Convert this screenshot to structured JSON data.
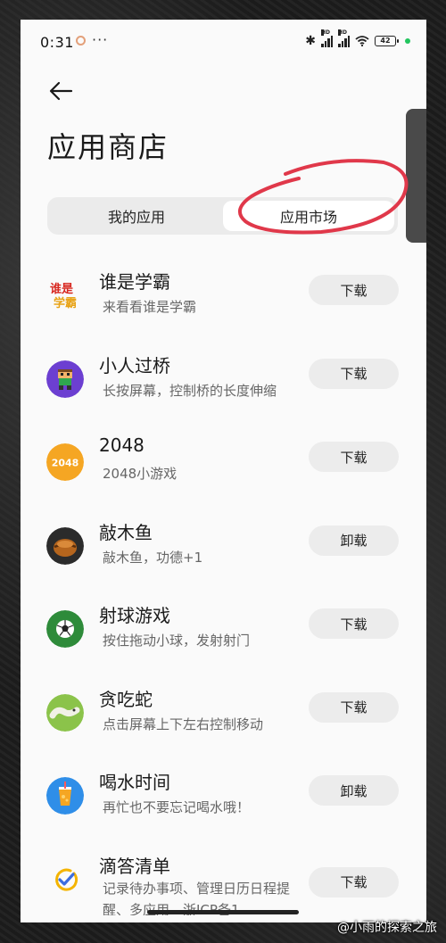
{
  "status_bar": {
    "time": "0:31",
    "more": "···",
    "battery": "42",
    "signal_label": "HD"
  },
  "header": {
    "title": "应用商店"
  },
  "tabs": [
    {
      "label": "我的应用",
      "selected": false
    },
    {
      "label": "应用市场",
      "selected": true
    }
  ],
  "apps": [
    {
      "name": "谁是学霸",
      "desc": "来看看谁是学霸",
      "button": "下载",
      "icon_text": "谁是\n学霸"
    },
    {
      "name": "小人过桥",
      "desc": "长按屏幕，控制桥的长度伸缩",
      "button": "下载"
    },
    {
      "name": "2048",
      "desc": "2048小游戏",
      "button": "下载",
      "icon_text": "2048"
    },
    {
      "name": "敲木鱼",
      "desc": "敲木鱼，功德+1",
      "button": "卸载"
    },
    {
      "name": "射球游戏",
      "desc": "按住拖动小球，发射射门",
      "button": "下载"
    },
    {
      "name": "贪吃蛇",
      "desc": "点击屏幕上下左右控制移动",
      "button": "下载"
    },
    {
      "name": "喝水时间",
      "desc": "再忙也不要忘记喝水哦！",
      "button": "卸载"
    },
    {
      "name": "滴答清单",
      "desc": "记录待办事项、管理日历日程提醒、多应用…浙ICP备1",
      "button": "下载"
    }
  ],
  "watermark": "@小雨的探索之旅",
  "colors": {
    "accent_annotation": "#e0384a",
    "button_bg": "#ececec",
    "page_bg": "#fafafa"
  }
}
